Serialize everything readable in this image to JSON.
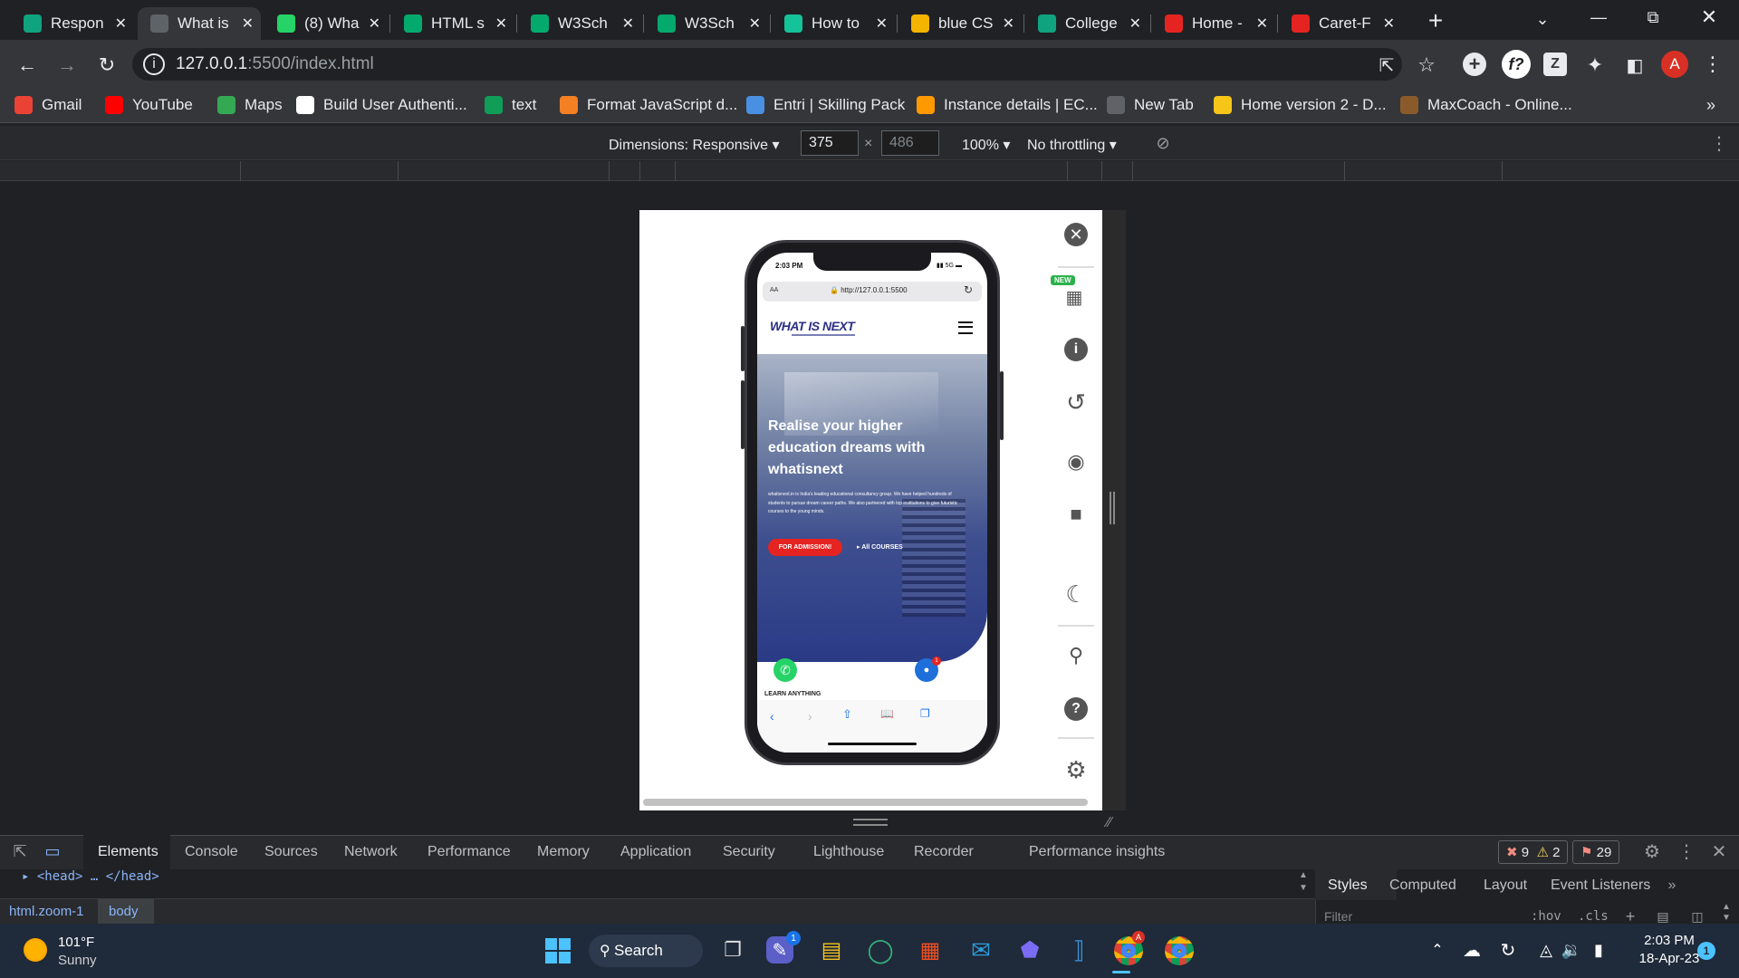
{
  "colors": {
    "accent": "#1a73e8",
    "admission": "#e52421",
    "whatsapp": "#25d366",
    "hero": "#2c3e7a",
    "new_badge": "#2bb24c"
  },
  "tabs": [
    {
      "label": "Respon",
      "icon": "chatgpt-icon",
      "color": "#10a37f"
    },
    {
      "label": "What is",
      "icon": "globe-icon",
      "color": "#5f6368",
      "active": true
    },
    {
      "label": "(8) Wha",
      "icon": "whatsapp-icon",
      "color": "#25d366"
    },
    {
      "label": "HTML s",
      "icon": "w3schools-icon",
      "color": "#04aa6d"
    },
    {
      "label": "W3Sch",
      "icon": "w3schools-icon",
      "color": "#04aa6d"
    },
    {
      "label": "W3Sch",
      "icon": "w3schools-icon",
      "color": "#04aa6d"
    },
    {
      "label": "How to",
      "icon": "grammarly-icon",
      "color": "#15c39a"
    },
    {
      "label": "blue CS",
      "icon": "avatar-icon",
      "color": "#f4b400"
    },
    {
      "label": "College",
      "icon": "college-icon",
      "color": "#0fa37f"
    },
    {
      "label": "Home -",
      "icon": "home-site-icon",
      "color": "#e52421"
    },
    {
      "label": "Caret-F",
      "icon": "pdf-icon",
      "color": "#e52421"
    }
  ],
  "url": "127.0.0.1:5500/index.html",
  "url_host": "127.0.0.1",
  "url_rest": ":5500/index.html",
  "profile_initial": "A",
  "bookmarks": [
    {
      "label": "Gmail",
      "icon": "gmail-icon",
      "color": "#ea4335"
    },
    {
      "label": "YouTube",
      "icon": "youtube-icon",
      "color": "#ff0000"
    },
    {
      "label": "Maps",
      "icon": "maps-icon",
      "color": "#34a853"
    },
    {
      "label": "Build User Authenti...",
      "icon": "bookmark-icon",
      "color": "#ffffff"
    },
    {
      "label": "text",
      "icon": "docs-icon",
      "color": "#0f9d58"
    },
    {
      "label": "Format JavaScript d...",
      "icon": "stackoverflow-icon",
      "color": "#f48024"
    },
    {
      "label": "Entri | Skilling Pack",
      "icon": "entri-icon",
      "color": "#4a90e2"
    },
    {
      "label": "Instance details | EC...",
      "icon": "aws-icon",
      "color": "#ff9900"
    },
    {
      "label": "New Tab",
      "icon": "chrome-icon",
      "color": "#5f6368"
    },
    {
      "label": "Home version 2 - D...",
      "icon": "maxcoach-icon",
      "color": "#f5c518"
    },
    {
      "label": "MaxCoach - Online...",
      "icon": "book-icon",
      "color": "#8b5a2b"
    }
  ],
  "device": {
    "dimensions_label": "Dimensions: Responsive",
    "width": "375",
    "height": "486",
    "zoom": "100%",
    "throttling": "No throttling"
  },
  "phone": {
    "status_time": "2:03 PM",
    "status_net": "5G",
    "address_aa": "AA",
    "address_url": "http://127.0.0.1:5500",
    "logo": "WHAT IS NEXT",
    "hero_title": "Realise your higher education dreams with whatisnext",
    "hero_text": "whatisnext.in is India's leading educational consultancy group. We have helped hundreds of students to pursue dream career paths. We also partnered with top institutions to give futuristic courses to the young minds.",
    "btn_admission": "FOR ADMISSION!",
    "btn_courses": "All COURSES",
    "learn_label": "LEARN ANYTHING",
    "chat_badge": "1"
  },
  "side_panel": {
    "new_badge": "NEW"
  },
  "devtools": {
    "tabs": [
      "Elements",
      "Console",
      "Sources",
      "Network",
      "Performance",
      "Memory",
      "Application",
      "Security",
      "Lighthouse",
      "Recorder",
      "Performance insights"
    ],
    "active_tab": "Elements",
    "errors": "9",
    "warnings": "2",
    "issues": "29",
    "dom_line": "<head> … </head>",
    "breadcrumbs": [
      "html.zoom-1",
      "body"
    ],
    "styles_tabs": [
      "Styles",
      "Computed",
      "Layout",
      "Event Listeners"
    ],
    "filter_placeholder": "Filter",
    "hov": ":hov",
    "cls": ".cls"
  },
  "taskbar": {
    "weather_temp": "101°F",
    "weather_desc": "Sunny",
    "search_label": "Search",
    "chat_badge": "1",
    "time": "2:03 PM",
    "date": "18-Apr-23",
    "notif": "1"
  }
}
